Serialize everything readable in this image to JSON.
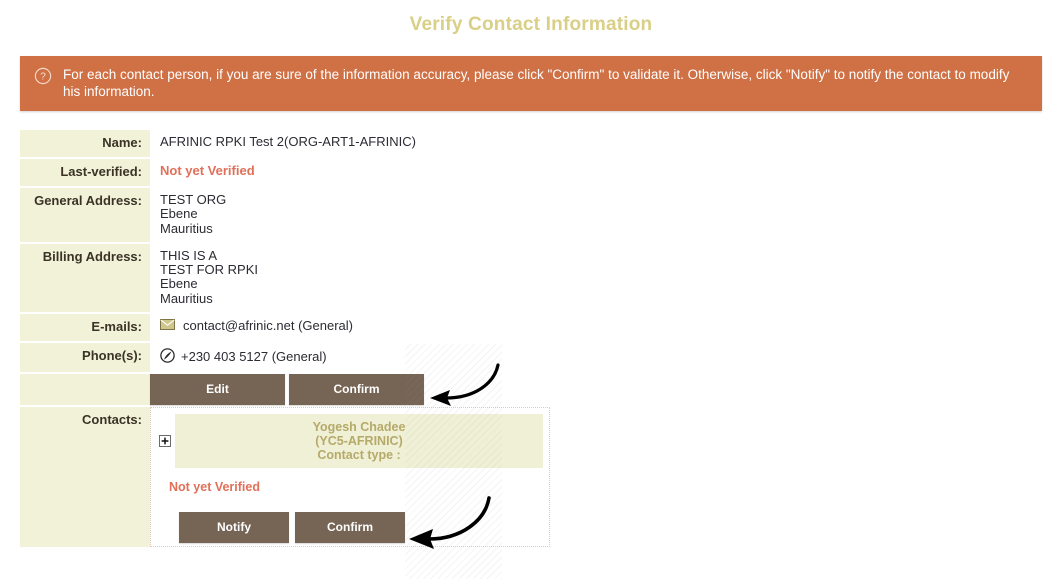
{
  "page": {
    "title": "Verify Contact Information"
  },
  "alert": {
    "icon": "question-circle-icon",
    "message": "For each contact person, if you are sure of the information accuracy, please click \"Confirm\" to validate it. Otherwise, click \"Notify\" to notify the contact to modify his information.",
    "background_color": "#cf7045",
    "text_color": "#ffffff"
  },
  "details": {
    "name": {
      "label": "Name:",
      "value": "AFRINIC RPKI Test 2(ORG-ART1-AFRINIC)"
    },
    "last_verified": {
      "label": "Last-verified:",
      "value": "Not yet Verified",
      "color": "#e0705a"
    },
    "general_address": {
      "label": "General Address:",
      "lines": [
        "TEST ORG",
        "Ebene",
        "Mauritius"
      ]
    },
    "billing_address": {
      "label": "Billing Address:",
      "lines": [
        "THIS IS A",
        "TEST FOR RPKI",
        "Ebene",
        "Mauritius"
      ]
    },
    "emails": {
      "label": "E-mails:",
      "icon": "envelope-icon",
      "value": "contact@afrinic.net (General)"
    },
    "phones": {
      "label": "Phone(s):",
      "icon": "phone-icon",
      "value": "+230 403 5127 (General)"
    },
    "org_actions": {
      "edit_label": "Edit",
      "confirm_label": "Confirm"
    },
    "contacts": {
      "label": "Contacts:",
      "expand_icon": "plus-box-icon",
      "items": [
        {
          "name": "Yogesh Chadee",
          "handle": "(YC5-AFRINIC)",
          "contact_type": "Contact type :",
          "status": "Not yet Verified",
          "notify_label": "Notify",
          "confirm_label": "Confirm"
        }
      ]
    }
  },
  "colors": {
    "title": "#d9cf86",
    "label_bg": "#f2f2d9",
    "button_bg": "#766455",
    "contact_head_text": "#b5aa6a",
    "status": "#e0705a"
  }
}
